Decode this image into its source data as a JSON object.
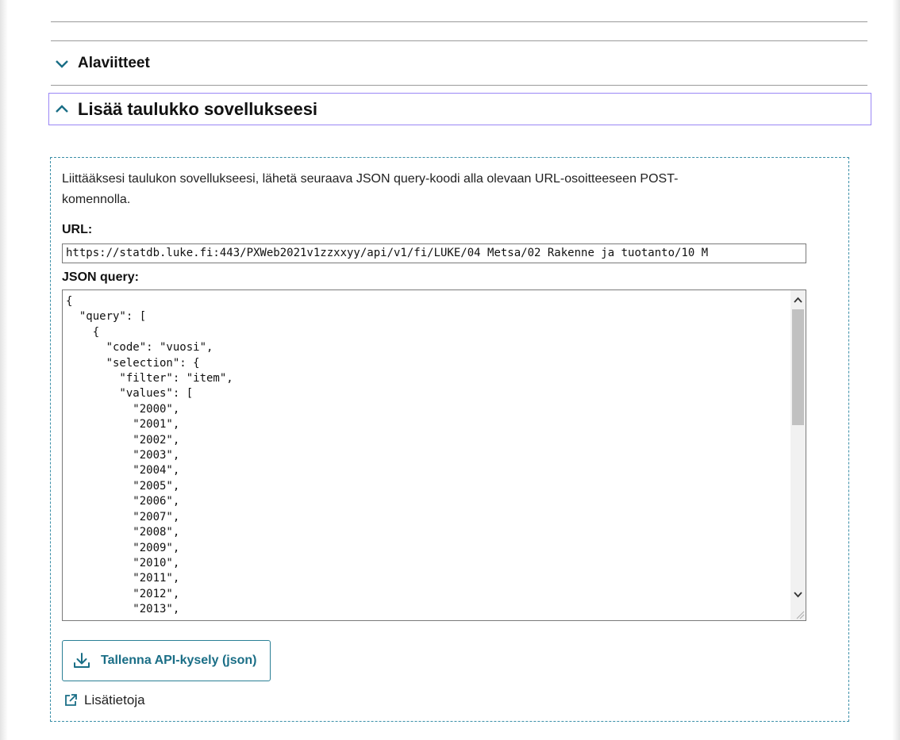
{
  "accordion": {
    "footnotes": {
      "label": "Alaviitteet",
      "icon": "chevron-down-icon"
    },
    "embed": {
      "label": "Lisää taulukko sovellukseesi",
      "icon": "chevron-up-icon"
    }
  },
  "embed_panel": {
    "intro_line1": "Liittääksesi taulukon sovellukseesi, lähetä seuraava JSON query-koodi alla olevaan URL-osoitteeseen POST-",
    "intro_line2": "komennolla.",
    "url_label": "URL:",
    "url_value": "https://statdb.luke.fi:443/PXWeb2021v1zzxxyy/api/v1/fi/LUKE/04 Metsa/02 Rakenne ja tuotanto/10 M",
    "json_label": "JSON query:",
    "json_text": "{\n  \"query\": [\n    {\n      \"code\": \"vuosi\",\n      \"selection\": {\n        \"filter\": \"item\",\n        \"values\": [\n          \"2000\",\n          \"2001\",\n          \"2002\",\n          \"2003\",\n          \"2004\",\n          \"2005\",\n          \"2006\",\n          \"2007\",\n          \"2008\",\n          \"2009\",\n          \"2010\",\n          \"2011\",\n          \"2012\",\n          \"2013\",",
    "save_button": {
      "label": "Tallenna API-kysely (json)",
      "icon": "download-icon"
    },
    "more_info": {
      "label": "Lisätietoja",
      "icon": "external-link-icon"
    }
  },
  "colors": {
    "accent": "#1a6e86",
    "focus_outline": "#9b87f5",
    "panel_border": "#3b8fa8"
  }
}
